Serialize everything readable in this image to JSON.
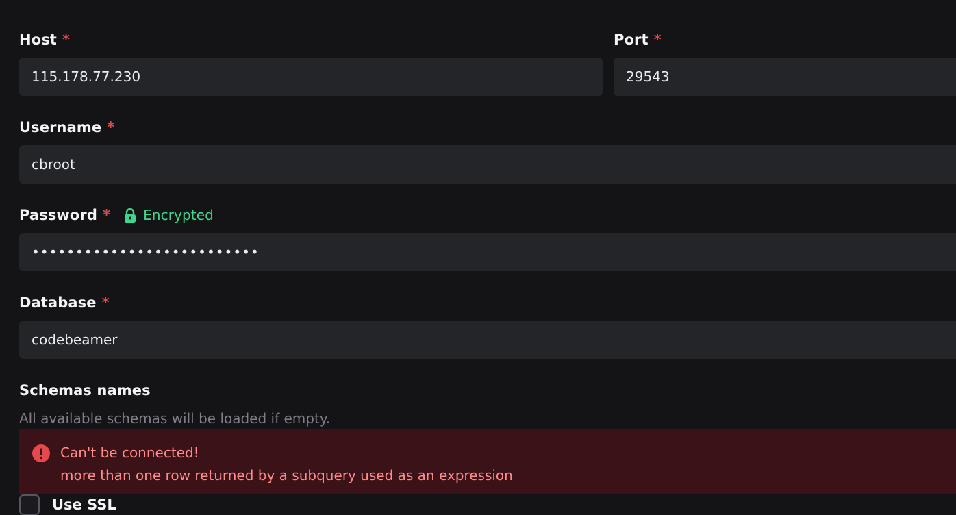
{
  "host": {
    "label": "Host",
    "required_mark": "*",
    "value": "115.178.77.230"
  },
  "port": {
    "label": "Port",
    "required_mark": "*",
    "value": "29543"
  },
  "username": {
    "label": "Username",
    "required_mark": "*",
    "value": "cbroot"
  },
  "password": {
    "label": "Password",
    "required_mark": "*",
    "status_icon": "lock-icon",
    "status_text": "Encrypted",
    "status_color": "#3dd68c",
    "masked_value": "••••••••••••••••••••••••••"
  },
  "database": {
    "label": "Database",
    "required_mark": "*",
    "value": "codebeamer"
  },
  "schemas": {
    "label": "Schemas names",
    "hint": "All available schemas will be loaded if empty."
  },
  "error": {
    "icon": "error-circle-icon",
    "title": "Can't be connected!",
    "message": "more than one row returned by a subquery used as an expression",
    "color": "#ff8b8b",
    "background": "#3b1217"
  },
  "use_ssl": {
    "label": "Use SSL",
    "checked": false
  },
  "colors": {
    "background": "#141417",
    "input_background": "#242529",
    "required": "#e5484d"
  }
}
